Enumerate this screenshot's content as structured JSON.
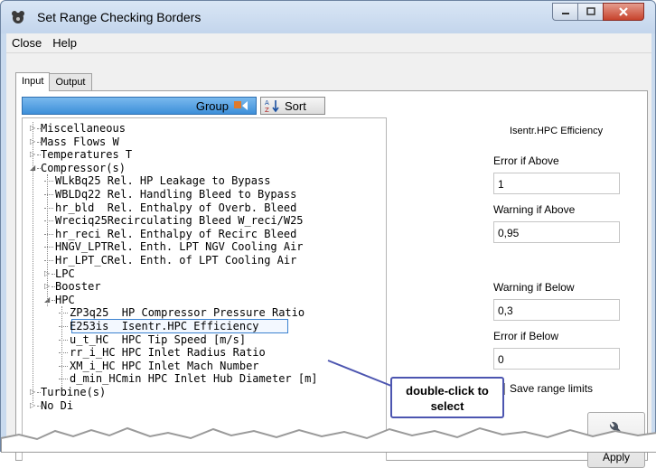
{
  "window": {
    "title": "Set Range Checking Borders"
  },
  "menu": {
    "items": [
      "Close",
      "Help"
    ]
  },
  "tabs": [
    "Input",
    "Output"
  ],
  "toolbar": {
    "group_label": "Group",
    "sort_label": "Sort"
  },
  "tree": [
    {
      "text": "Miscellaneous",
      "level": 0,
      "toggle": "▷"
    },
    {
      "text": "Mass Flows W",
      "level": 0,
      "toggle": "▷"
    },
    {
      "text": "Temperatures T",
      "level": 0,
      "toggle": "▷"
    },
    {
      "text": "Compressor(s)",
      "level": 0,
      "toggle": "◢"
    },
    {
      "text": "WLkBq25 Rel. HP Leakage to Bypass",
      "level": 1,
      "toggle": ""
    },
    {
      "text": "WBLDq22 Rel. Handling Bleed to Bypass",
      "level": 1,
      "toggle": ""
    },
    {
      "text": "hr_bld  Rel. Enthalpy of Overb. Bleed",
      "level": 1,
      "toggle": ""
    },
    {
      "text": "Wreciq25Recirculating Bleed W_reci/W25",
      "level": 1,
      "toggle": ""
    },
    {
      "text": "hr_reci Rel. Enthalpy of Recirc Bleed",
      "level": 1,
      "toggle": ""
    },
    {
      "text": "HNGV_LPTRel. Enth. LPT NGV Cooling Air",
      "level": 1,
      "toggle": ""
    },
    {
      "text": "Hr_LPT_CRel. Enth. of LPT Cooling Air",
      "level": 1,
      "toggle": ""
    },
    {
      "text": "LPC",
      "level": 1,
      "toggle": "▷"
    },
    {
      "text": "Booster",
      "level": 1,
      "toggle": "▷"
    },
    {
      "text": "HPC",
      "level": 1,
      "toggle": "◢"
    },
    {
      "text": "ZP3q25  HP Compressor Pressure Ratio",
      "level": 2,
      "toggle": ""
    },
    {
      "text": "E253is  Isentr.HPC Efficiency",
      "level": 2,
      "toggle": "",
      "selected": true
    },
    {
      "text": "u_t_HC  HPC Tip Speed [m/s]",
      "level": 2,
      "toggle": ""
    },
    {
      "text": "rr_i_HC HPC Inlet Radius Ratio",
      "level": 2,
      "toggle": ""
    },
    {
      "text": "XM_i_HC HPC Inlet Mach Number",
      "level": 2,
      "toggle": ""
    },
    {
      "text": "d_min_HCmin HPC Inlet Hub Diameter [m]",
      "level": 2,
      "toggle": ""
    },
    {
      "text": "Turbine(s)",
      "level": 0,
      "toggle": "▷"
    },
    {
      "text": "No Di",
      "level": 0,
      "toggle": "▷"
    }
  ],
  "right_panel": {
    "heading": "Isentr.HPC Efficiency",
    "error_above_label": "Error if Above",
    "error_above_value": "1",
    "warning_above_label": "Warning if Above",
    "warning_above_value": "0,95",
    "warning_below_label": "Warning if Below",
    "warning_below_value": "0,3",
    "error_below_label": "Error if Below",
    "error_below_value": "0",
    "save_label": "Save range limits",
    "apply_label": "Apply"
  },
  "callout": {
    "line1": "double-click to",
    "line2": "select"
  }
}
